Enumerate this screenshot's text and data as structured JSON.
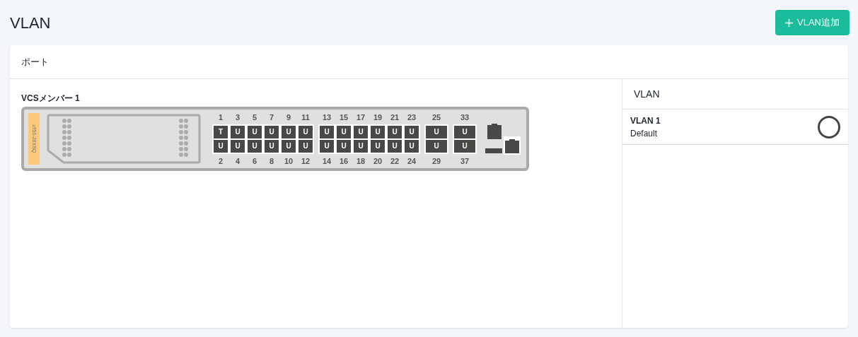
{
  "page_title": "VLAN",
  "add_button": {
    "label": "VLAN追加"
  },
  "card_title": "ポート",
  "member": {
    "title": "VCSメンバー 1",
    "model": "x950-28XSQ",
    "port_groups": [
      {
        "columns": [
          {
            "top_number": "1",
            "top_mode": "T",
            "bottom_mode": "U",
            "bottom_number": "2"
          },
          {
            "top_number": "3",
            "top_mode": "U",
            "bottom_mode": "U",
            "bottom_number": "4"
          },
          {
            "top_number": "5",
            "top_mode": "U",
            "bottom_mode": "U",
            "bottom_number": "6"
          },
          {
            "top_number": "7",
            "top_mode": "U",
            "bottom_mode": "U",
            "bottom_number": "8"
          },
          {
            "top_number": "9",
            "top_mode": "U",
            "bottom_mode": "U",
            "bottom_number": "10"
          },
          {
            "top_number": "11",
            "top_mode": "U",
            "bottom_mode": "U",
            "bottom_number": "12"
          }
        ]
      },
      {
        "columns": [
          {
            "top_number": "13",
            "top_mode": "U",
            "bottom_mode": "U",
            "bottom_number": "14"
          },
          {
            "top_number": "15",
            "top_mode": "U",
            "bottom_mode": "U",
            "bottom_number": "16"
          },
          {
            "top_number": "17",
            "top_mode": "U",
            "bottom_mode": "U",
            "bottom_number": "18"
          },
          {
            "top_number": "19",
            "top_mode": "U",
            "bottom_mode": "U",
            "bottom_number": "20"
          },
          {
            "top_number": "21",
            "top_mode": "U",
            "bottom_mode": "U",
            "bottom_number": "22"
          },
          {
            "top_number": "23",
            "top_mode": "U",
            "bottom_mode": "U",
            "bottom_number": "24"
          }
        ]
      },
      {
        "columns": [
          {
            "top_number": "25",
            "top_mode": "U",
            "bottom_mode": "U",
            "bottom_number": "29"
          }
        ]
      },
      {
        "columns": [
          {
            "top_number": "33",
            "top_mode": "U",
            "bottom_mode": "U",
            "bottom_number": "37"
          }
        ]
      }
    ]
  },
  "vlan_panel": {
    "title": "VLAN",
    "items": [
      {
        "name": "VLAN 1",
        "description": "Default",
        "selected": false
      }
    ]
  }
}
